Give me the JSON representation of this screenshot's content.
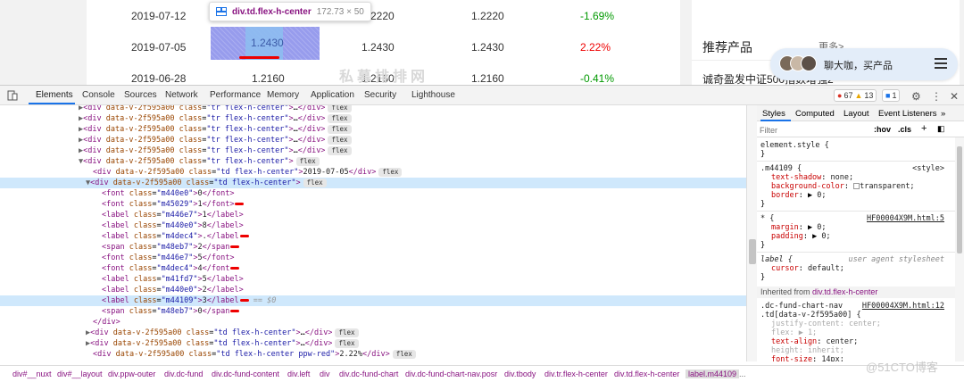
{
  "page": {
    "rows": [
      {
        "date": "2019-07-12",
        "v1": "",
        "v2": "1.2220",
        "v3": "1.2220",
        "change": "-1.69%",
        "dir": "down"
      },
      {
        "date": "2019-07-05",
        "v1": "1.2430",
        "v2": "1.2430",
        "v3": "1.2430",
        "change": "2.22%",
        "dir": "up"
      },
      {
        "date": "2019-06-28",
        "v1": "1.2160",
        "v2": "1.2160",
        "v3": "1.2160",
        "change": "-0.41%",
        "dir": "down"
      }
    ],
    "watermark": "私募排排网",
    "tooltip": {
      "selector": "div.td.flex-h-center",
      "size": "172.73 × 50"
    },
    "sidebar": {
      "title": "推荐产品",
      "more": "更多>",
      "item": "诚奇盈发中证500指数增强2"
    },
    "chat": {
      "text": "聊大咖，买产品"
    }
  },
  "devtools": {
    "tabs": [
      "Elements",
      "Console",
      "Sources",
      "Network",
      "Performance",
      "Memory",
      "Application",
      "Security",
      "Lighthouse"
    ],
    "errors": "67",
    "warnings": "13",
    "messages": "1",
    "style_tabs": [
      "Styles",
      "Computed",
      "Layout",
      "Event Listeners",
      "»"
    ],
    "filter_placeholder": "Filter",
    "hov": ":hov",
    "cls": ".cls",
    "breadcrumbs": [
      "div#__nuxt",
      "div#__layout",
      "div.ppw-outer",
      "div.dc-fund",
      "div.dc-fund-content",
      "div.left",
      "div",
      "div.dc-fund-chart",
      "div.dc-fund-chart-nav.posr",
      "div.tbody",
      "div.tr.flex-h-center",
      "div.td.flex-h-center",
      "label.m44109",
      "..."
    ],
    "watermark": "@51CTO博客"
  },
  "colors": {
    "accent": "#1a73e8",
    "tag": "#881280",
    "attr": "#994500",
    "value": "#1a1aa6",
    "up": "#e00000",
    "down": "#009900",
    "highlight": "#6f76e6"
  }
}
